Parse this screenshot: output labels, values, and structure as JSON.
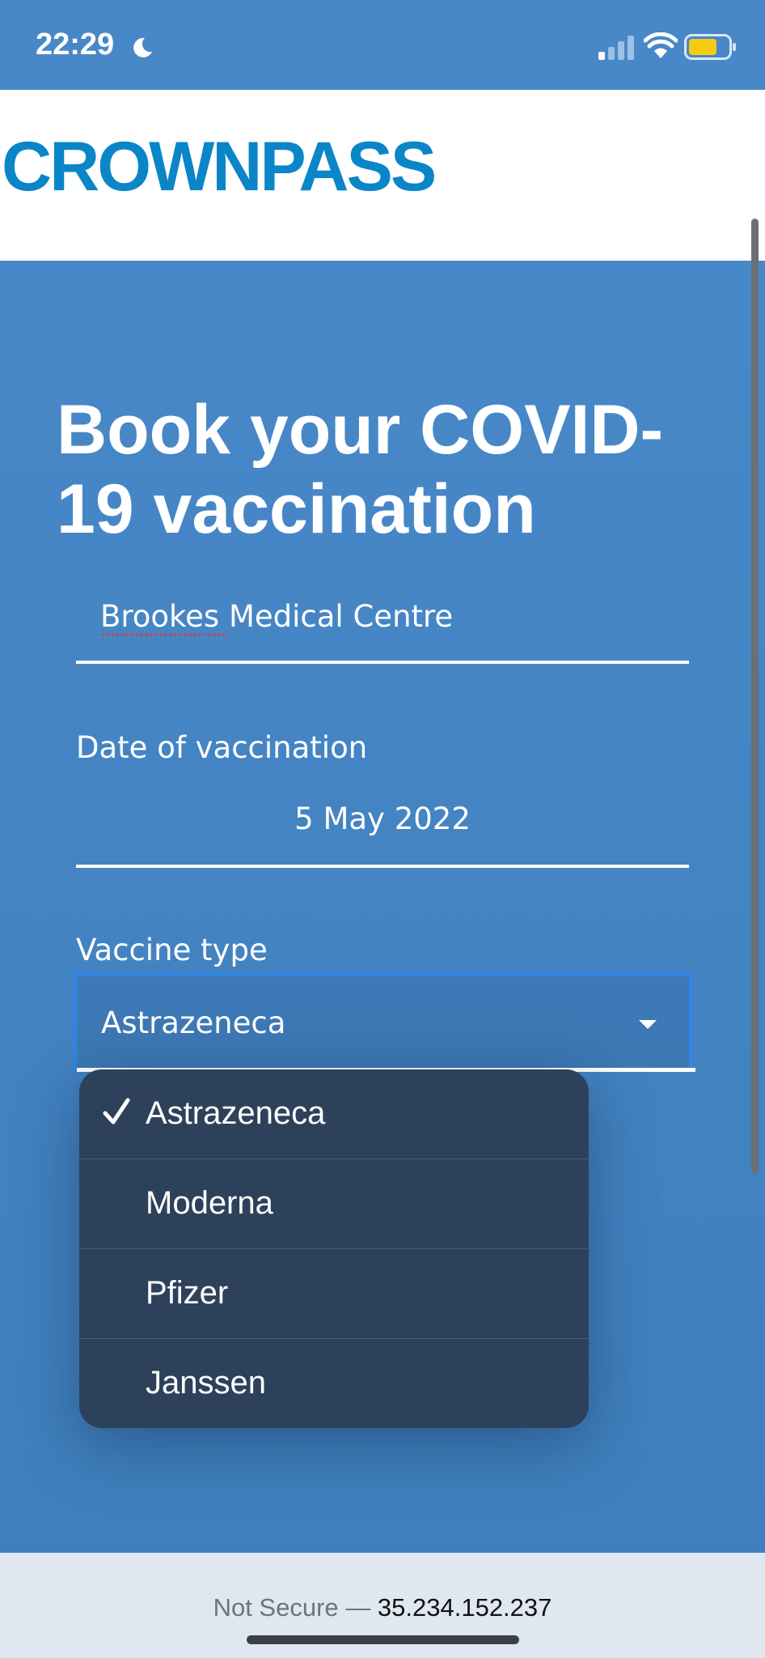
{
  "status_bar": {
    "time": "22:29",
    "icons": [
      "moon-icon",
      "cellular-signal-icon",
      "wifi-icon",
      "battery-icon"
    ],
    "battery_color": "#f5cc14"
  },
  "header": {
    "logo_text": "CROWNPASS",
    "logo_color": "#0a86c8"
  },
  "page": {
    "title": "Book your COVID-19 vaccination",
    "background_color": "#4888c8"
  },
  "form": {
    "clinic": {
      "value": "Brookes Medical Centre"
    },
    "date": {
      "label": "Date of vaccination",
      "value": "5 May 2022"
    },
    "vaccine": {
      "label": "Vaccine type",
      "value": "Astrazeneca",
      "focus_color": "#2f86e8"
    }
  },
  "dropdown": {
    "options": [
      {
        "label": "Astrazeneca",
        "selected": true
      },
      {
        "label": "Moderna",
        "selected": false
      },
      {
        "label": "Pfizer",
        "selected": false
      },
      {
        "label": "Janssen",
        "selected": false
      }
    ]
  },
  "browser_bar": {
    "security_label": "Not Secure —",
    "host": "35.234.152.237"
  }
}
